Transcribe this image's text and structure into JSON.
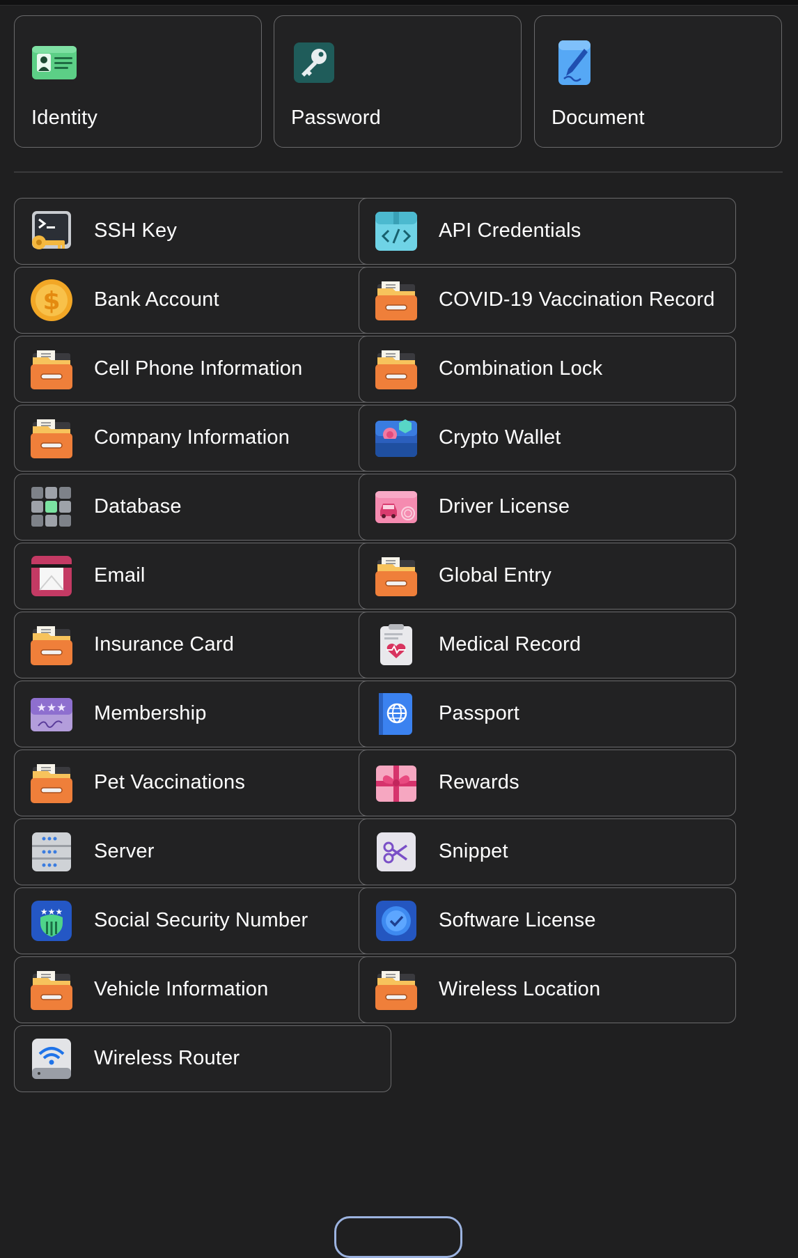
{
  "featured": [
    {
      "label": "Identity",
      "icon": "id-card-icon"
    },
    {
      "label": "Password",
      "icon": "key-icon"
    },
    {
      "label": "Document",
      "icon": "document-pen-icon"
    }
  ],
  "categories": [
    {
      "label": "SSH Key",
      "icon": "ssh-key-icon"
    },
    {
      "label": "API Credentials",
      "icon": "api-credentials-icon"
    },
    {
      "label": "Bank Account",
      "icon": "dollar-coin-icon"
    },
    {
      "label": "COVID-19 Vaccination Record",
      "icon": "folder-drawer-icon"
    },
    {
      "label": "Cell Phone Information",
      "icon": "folder-drawer-icon"
    },
    {
      "label": "Combination Lock",
      "icon": "folder-drawer-icon"
    },
    {
      "label": "Company Information",
      "icon": "folder-drawer-icon"
    },
    {
      "label": "Crypto Wallet",
      "icon": "crypto-wallet-icon"
    },
    {
      "label": "Database",
      "icon": "database-grid-icon"
    },
    {
      "label": "Driver License",
      "icon": "driver-license-icon"
    },
    {
      "label": "Email",
      "icon": "envelope-icon"
    },
    {
      "label": "Global Entry",
      "icon": "folder-drawer-icon"
    },
    {
      "label": "Insurance Card",
      "icon": "folder-drawer-icon"
    },
    {
      "label": "Medical Record",
      "icon": "medical-clipboard-icon"
    },
    {
      "label": "Membership",
      "icon": "membership-card-icon"
    },
    {
      "label": "Passport",
      "icon": "passport-globe-icon"
    },
    {
      "label": "Pet Vaccinations",
      "icon": "folder-drawer-icon"
    },
    {
      "label": "Rewards",
      "icon": "gift-icon"
    },
    {
      "label": "Server",
      "icon": "server-icon"
    },
    {
      "label": "Snippet",
      "icon": "scissors-icon"
    },
    {
      "label": "Social Security Number",
      "icon": "ssn-shield-icon"
    },
    {
      "label": "Software License",
      "icon": "verified-badge-icon"
    },
    {
      "label": "Vehicle Information",
      "icon": "folder-drawer-icon"
    },
    {
      "label": "Wireless Location",
      "icon": "folder-drawer-icon"
    },
    {
      "label": "Wireless Router",
      "icon": "wifi-router-icon"
    }
  ]
}
